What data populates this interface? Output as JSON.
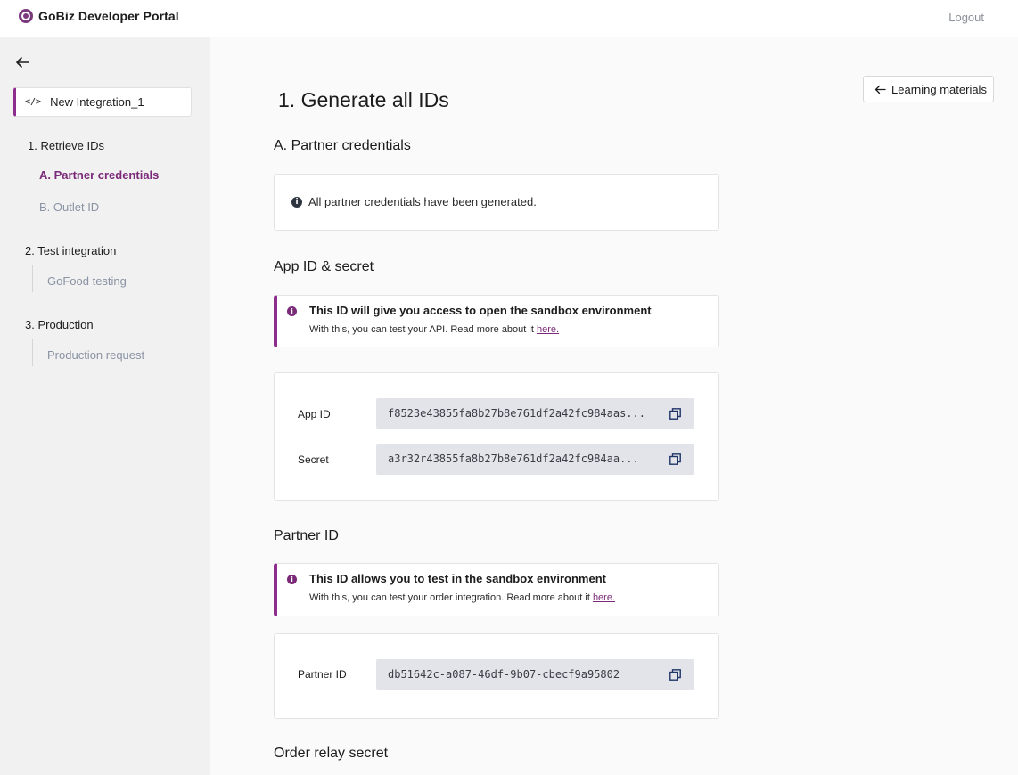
{
  "header": {
    "brand": "GoBiz Developer Portal",
    "logout_label": "Logout"
  },
  "sidebar": {
    "integration_name": "New Integration_1",
    "sections": [
      {
        "title": "1. Retrieve IDs",
        "items": [
          "A. Partner credentials",
          "B. Outlet ID"
        ]
      },
      {
        "title": "2. Test integration",
        "items": [
          "GoFood testing"
        ]
      },
      {
        "title": "3. Production",
        "items": [
          "Production request"
        ]
      }
    ]
  },
  "main": {
    "title": "1. Generate all IDs",
    "learning_label": "Learning materials",
    "partner_credentials": {
      "title": "A. Partner credentials",
      "notice": "All partner credentials have been generated."
    },
    "app_secret": {
      "title": "App ID & secret",
      "callout_title": "This ID will give you access to open the sandbox environment",
      "callout_body": "With this, you can test your API. Read more about it ",
      "callout_link": "here.",
      "app_id_label": "App ID",
      "app_id_value": "f8523e43855fa8b27b8e761df2a42fc984aas...",
      "secret_label": "Secret",
      "secret_value": "a3r32r43855fa8b27b8e761df2a42fc984aa..."
    },
    "partner_id": {
      "title": "Partner ID",
      "callout_title": "This ID allows you to test in the sandbox environment",
      "callout_body": "With this, you can test your order integration. Read more about it ",
      "callout_link": "here.",
      "label": "Partner ID",
      "value": "db51642c-a087-46df-9b07-cbecf9a95802"
    },
    "order_relay": {
      "title": "Order relay secret"
    }
  },
  "colors": {
    "accent": "#8e2e8c",
    "sidebar_bg": "#f1f1f1",
    "field_bg": "#e2e4ea"
  }
}
